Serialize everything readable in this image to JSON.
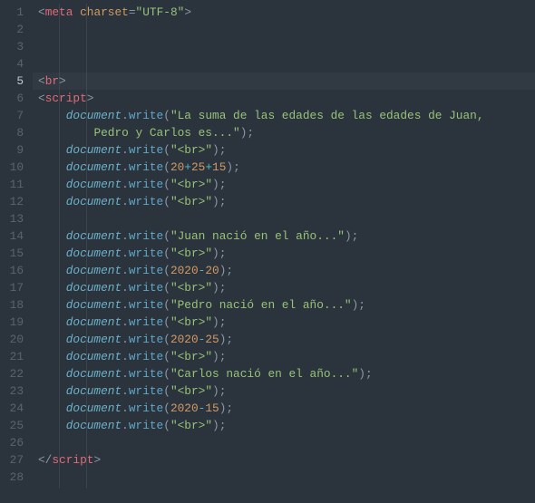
{
  "gutter": {
    "lines": [
      "1",
      "2",
      "3",
      "4",
      "5",
      "6",
      "7",
      "8",
      "9",
      "10",
      "11",
      "12",
      "13",
      "14",
      "15",
      "16",
      "17",
      "18",
      "19",
      "20",
      "21",
      "22",
      "23",
      "24",
      "25",
      "26",
      "27",
      "28"
    ],
    "current": "5"
  },
  "code": {
    "angleOpen": "<",
    "angleCloseOpen": "</",
    "angleEnd": ">",
    "eq": "=",
    "tags": {
      "meta": "meta",
      "br": "br",
      "script": "script"
    },
    "metaAttr": "charset",
    "metaVal": "\"UTF-8\"",
    "obj": "document",
    "dot": ".",
    "fn": "write",
    "paren_o": "(",
    "paren_c": ")",
    "semi": ";",
    "indent1": "    ",
    "indent2": "        ",
    "indent3": "            ",
    "strings": {
      "suma_a": "\"La suma de las edades de las edades de Juan, ",
      "suma_b": "Pedro y Carlos es...\"",
      "br": "\"<br>\"",
      "juan": "\"Juan nació en el año...\"",
      "pedro": "\"Pedro nació en el año...\"",
      "carlos": "\"Carlos nació en el año...\""
    },
    "nums": {
      "n20": "20",
      "n25": "25",
      "n15": "15",
      "n2020": "2020"
    },
    "ops": {
      "plus": "+",
      "minus": "-"
    }
  }
}
